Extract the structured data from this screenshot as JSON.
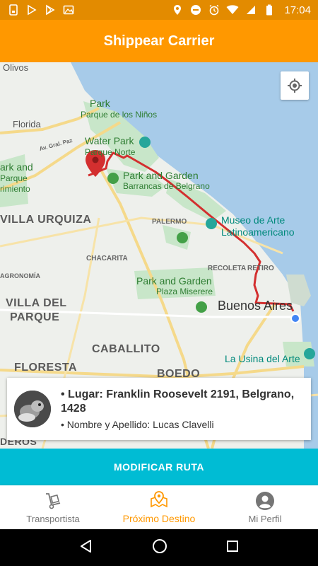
{
  "status_bar": {
    "time": "17:04",
    "left_icons": [
      "sim-icon",
      "play-store-icon",
      "play-store-icon",
      "gallery-icon"
    ],
    "right_icons": [
      "location-icon",
      "do-not-disturb-icon",
      "alarm-icon",
      "wifi-icon",
      "signal-icon",
      "battery-icon"
    ]
  },
  "app_bar": {
    "title": "Shippear Carrier"
  },
  "map": {
    "labels": {
      "olivos": "Olivos",
      "florida": "Florida",
      "park": "Park",
      "parque_ninos": "Parque de los Niños",
      "av_gral_paz": "Av. Gral. Paz",
      "water_park": "Water Park",
      "parque_norte": "Parque Norte",
      "park_and_garden_1": "Park and Garden",
      "barrancas": "Barrancas de Belgrano",
      "villa_urquiza": "VILLA URQUIZA",
      "palermo": "PALERMO",
      "museo_1": "Museo de Arte",
      "museo_2": "Latinoamericano",
      "chacarita": "CHACARITA",
      "agronomia": "AGRONOMÍA",
      "recoleta": "RECOLETA",
      "retiro": "RETIRO",
      "park_and_garden_2": "Park and Garden",
      "plaza_miserere": "Plaza Miserere",
      "villa_del": "VILLA DEL",
      "parque": "PARQUE",
      "buenos_aires": "Buenos Aires",
      "caballito": "CABALLITO",
      "floresta": "FLORESTA",
      "boedo": "BOEDO",
      "usina": "La Usina del Arte",
      "left_park_1": "ark and",
      "left_park_2": "Parque",
      "left_park_3": "rimiento",
      "deros": "DEROS"
    },
    "locate_button_icon": "my-location-icon",
    "route_color": "#d32f2f"
  },
  "info_card": {
    "place_line": "• Lugar: Franklin Roosevelt 2191, Belgrano, 1428",
    "name_line": "• Nombre y Apellido: Lucas Clavelli"
  },
  "route_button": {
    "label": "MODIFICAR RUTA"
  },
  "bottom_nav": {
    "items": [
      {
        "label": "Transportista",
        "icon": "hand-truck-icon",
        "active": false
      },
      {
        "label": "Próximo Destino",
        "icon": "map-pin-icon",
        "active": true
      },
      {
        "label": "Mi Perfil",
        "icon": "account-circle-icon",
        "active": false
      }
    ]
  },
  "colors": {
    "status_bar": "#e38b00",
    "app_bar": "#ff9800",
    "route_button": "#00bcd4",
    "active_tab": "#ff9800"
  }
}
